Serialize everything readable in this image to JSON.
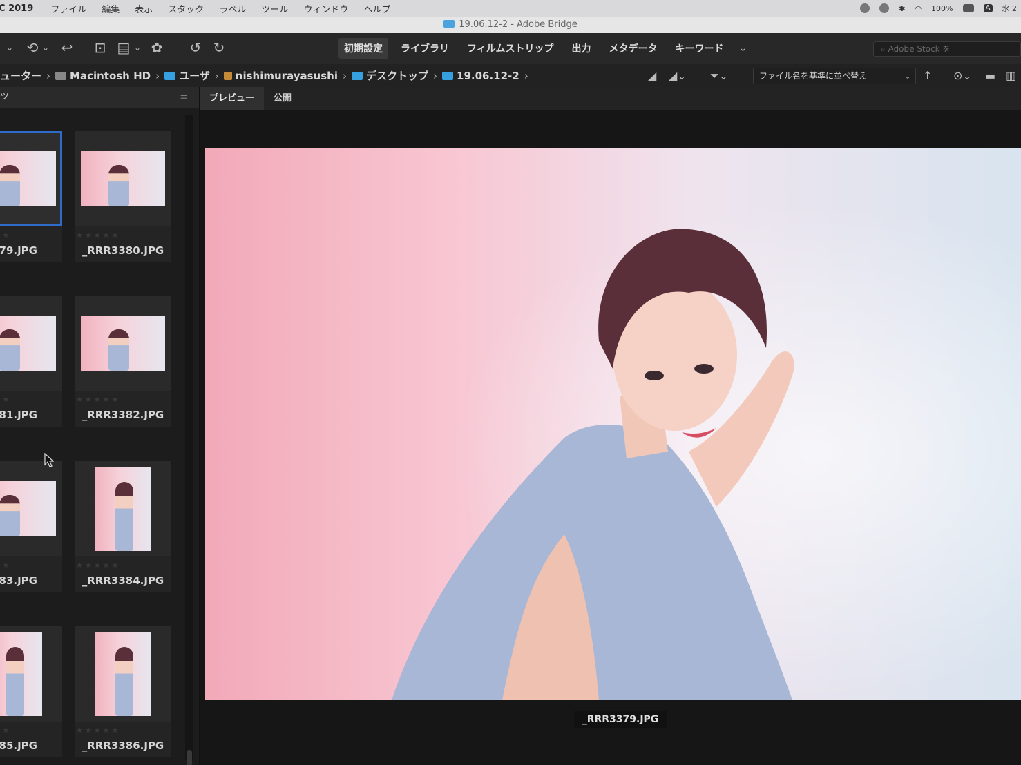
{
  "menubar": {
    "app_name": "C 2019",
    "items": [
      "ファイル",
      "編集",
      "表示",
      "スタック",
      "ラベル",
      "ツール",
      "ウィンドウ",
      "ヘルプ"
    ],
    "battery": "100%",
    "input_indicator": "A",
    "clock": "水 2"
  },
  "window": {
    "title": "19.06.12-2 - Adobe Bridge"
  },
  "toolbar": {
    "workspaces": [
      "初期設定",
      "ライブラリ",
      "フィルムストリップ",
      "出力",
      "メタデータ",
      "キーワード"
    ],
    "active_workspace": "初期設定",
    "search_placeholder": "Adobe Stock を"
  },
  "pathbar": {
    "crumbs": [
      {
        "label": "ューター",
        "icon": "none"
      },
      {
        "label": "Macintosh HD",
        "icon": "hd-icon"
      },
      {
        "label": "ユーザ",
        "icon": "folder-icon"
      },
      {
        "label": "nishimurayasushi",
        "icon": "home-icon"
      },
      {
        "label": "デスクトップ",
        "icon": "folder-icon"
      },
      {
        "label": "19.06.12-2",
        "icon": "folder-icon"
      }
    ],
    "sort_label": "ファイル名を基準に並べ替え"
  },
  "content_panel": {
    "title": "ツ",
    "thumbnails": [
      {
        "name": "79.JPG",
        "orientation": "landscape",
        "selected": true
      },
      {
        "name": "_RRR3380.JPG",
        "orientation": "landscape",
        "selected": false
      },
      {
        "name": "81.JPG",
        "orientation": "landscape",
        "selected": false
      },
      {
        "name": "_RRR3382.JPG",
        "orientation": "landscape",
        "selected": false
      },
      {
        "name": "83.JPG",
        "orientation": "landscape",
        "selected": false
      },
      {
        "name": "_RRR3384.JPG",
        "orientation": "portrait",
        "selected": false
      },
      {
        "name": "85.JPG",
        "orientation": "portrait",
        "selected": false
      },
      {
        "name": "_RRR3386.JPG",
        "orientation": "portrait",
        "selected": false
      }
    ]
  },
  "preview_panel": {
    "tabs": [
      "プレビュー",
      "公開"
    ],
    "active_tab": "プレビュー",
    "caption": "_RRR3379.JPG"
  },
  "colors": {
    "selection": "#2f6bc8",
    "folder": "#36a0e0",
    "panel_bg": "#1c1c1c"
  }
}
